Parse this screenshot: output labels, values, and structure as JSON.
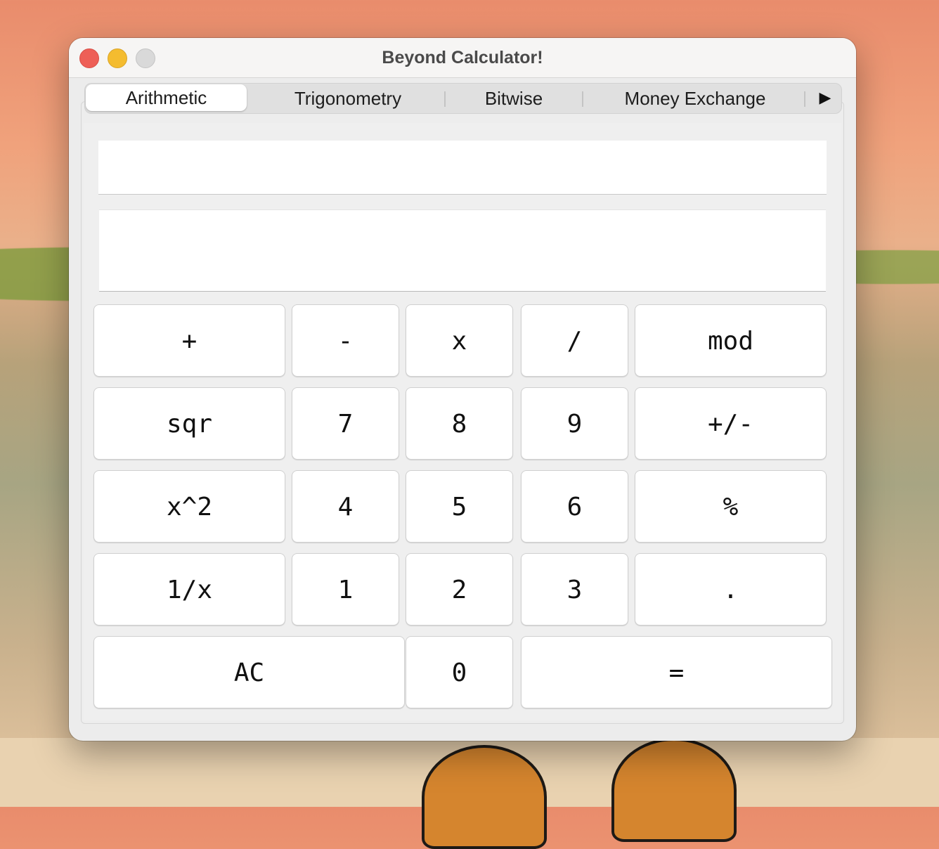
{
  "window": {
    "title": "Beyond Calculator!"
  },
  "tabs": [
    {
      "label": "Arithmetic",
      "selected": true
    },
    {
      "label": "Trigonometry",
      "selected": false
    },
    {
      "label": "Bitwise",
      "selected": false
    },
    {
      "label": "Money Exchange",
      "selected": false
    }
  ],
  "tab_scroll_icon": "right-triangle-icon",
  "displays": {
    "expression": "",
    "result": ""
  },
  "keypad": {
    "row1": [
      "+",
      "-",
      "x",
      "/",
      "mod"
    ],
    "row2": [
      "sqr",
      "7",
      "8",
      "9",
      "+/-"
    ],
    "row3": [
      "x^2",
      "4",
      "5",
      "6",
      "%"
    ],
    "row4": [
      "1/x",
      "1",
      "2",
      "3",
      "."
    ],
    "row5": [
      "AC",
      "0",
      "="
    ]
  },
  "colors": {
    "close": "#ee5f57",
    "minimize": "#f4bc2f",
    "zoom": "#d9d9d9"
  }
}
